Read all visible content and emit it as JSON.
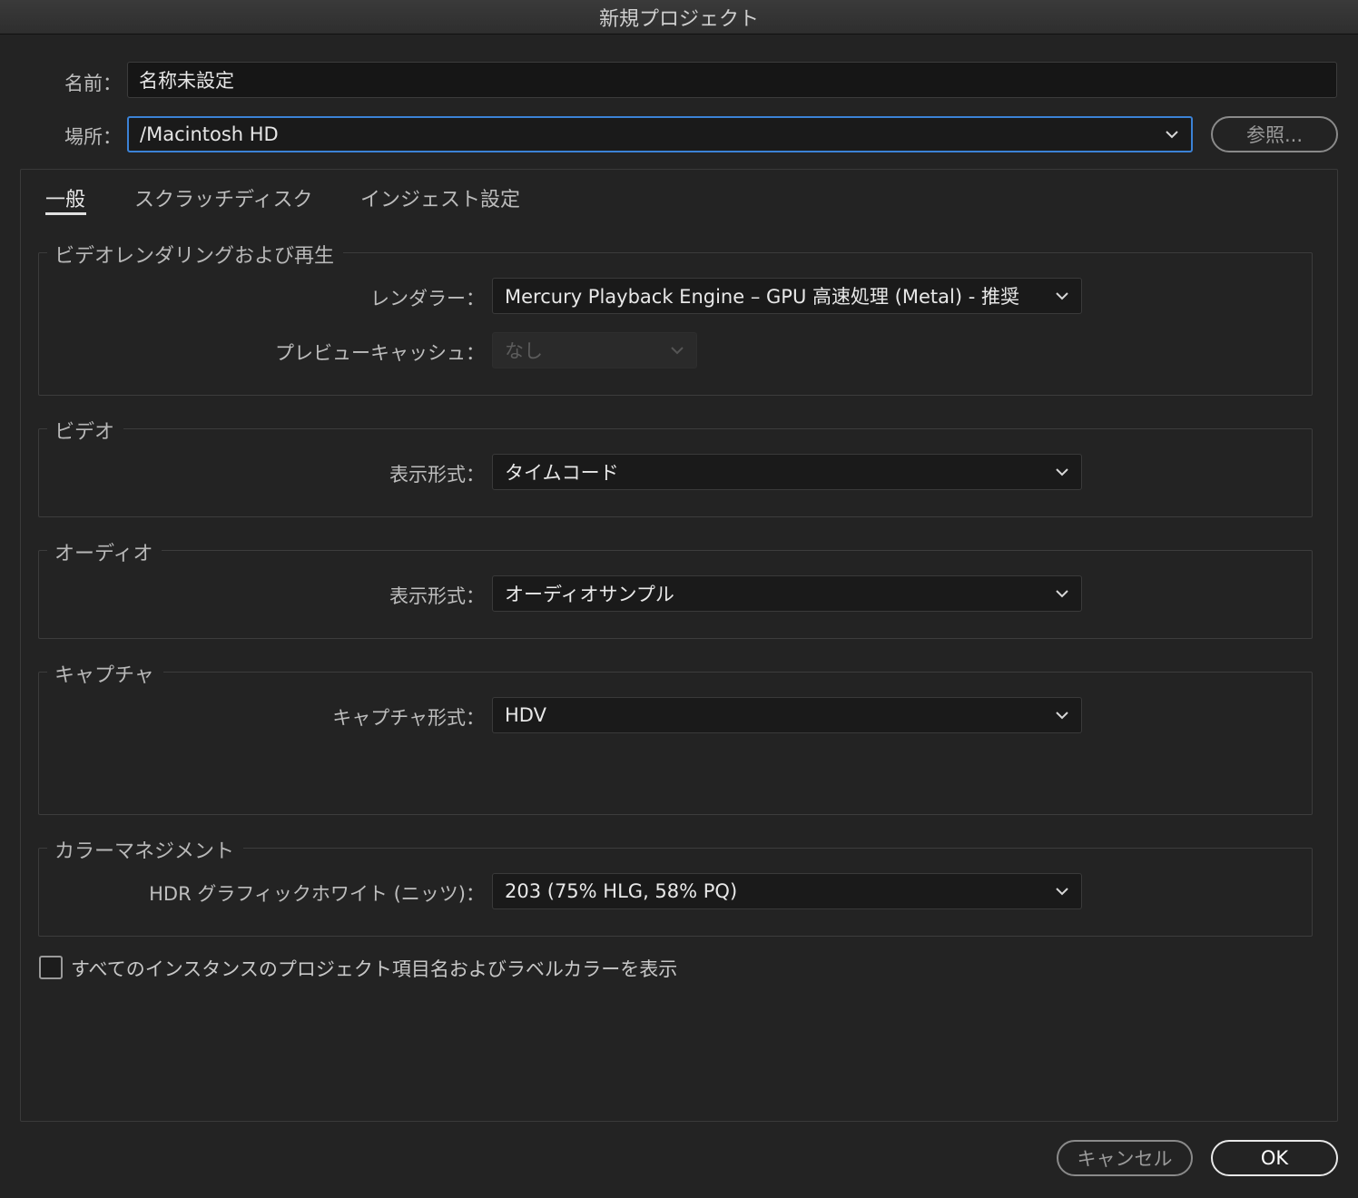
{
  "window": {
    "title": "新規プロジェクト"
  },
  "header": {
    "name_label": "名前：",
    "name_value": "名称未設定",
    "location_label": "場所：",
    "location_value": "/Macintosh HD",
    "browse_label": "参照..."
  },
  "tabs": [
    {
      "label": "一般",
      "active": true
    },
    {
      "label": "スクラッチディスク",
      "active": false
    },
    {
      "label": "インジェスト設定",
      "active": false
    }
  ],
  "sections": {
    "rendering": {
      "legend": "ビデオレンダリングおよび再生",
      "renderer_label": "レンダラー：",
      "renderer_value": "Mercury Playback Engine – GPU 高速処理 (Metal) - 推奨",
      "preview_cache_label": "プレビューキャッシュ：",
      "preview_cache_value": "なし"
    },
    "video": {
      "legend": "ビデオ",
      "display_format_label": "表示形式：",
      "display_format_value": "タイムコード"
    },
    "audio": {
      "legend": "オーディオ",
      "display_format_label": "表示形式：",
      "display_format_value": "オーディオサンプル"
    },
    "capture": {
      "legend": "キャプチャ",
      "capture_format_label": "キャプチャ形式：",
      "capture_format_value": "HDV"
    },
    "color": {
      "legend": "カラーマネジメント",
      "hdr_label": "HDR グラフィックホワイト (ニッツ)：",
      "hdr_value": "203 (75% HLG, 58% PQ)"
    }
  },
  "checkbox": {
    "label": "すべてのインスタンスのプロジェクト項目名およびラベルカラーを表示",
    "checked": false
  },
  "footer": {
    "cancel_label": "キャンセル",
    "ok_label": "OK"
  }
}
